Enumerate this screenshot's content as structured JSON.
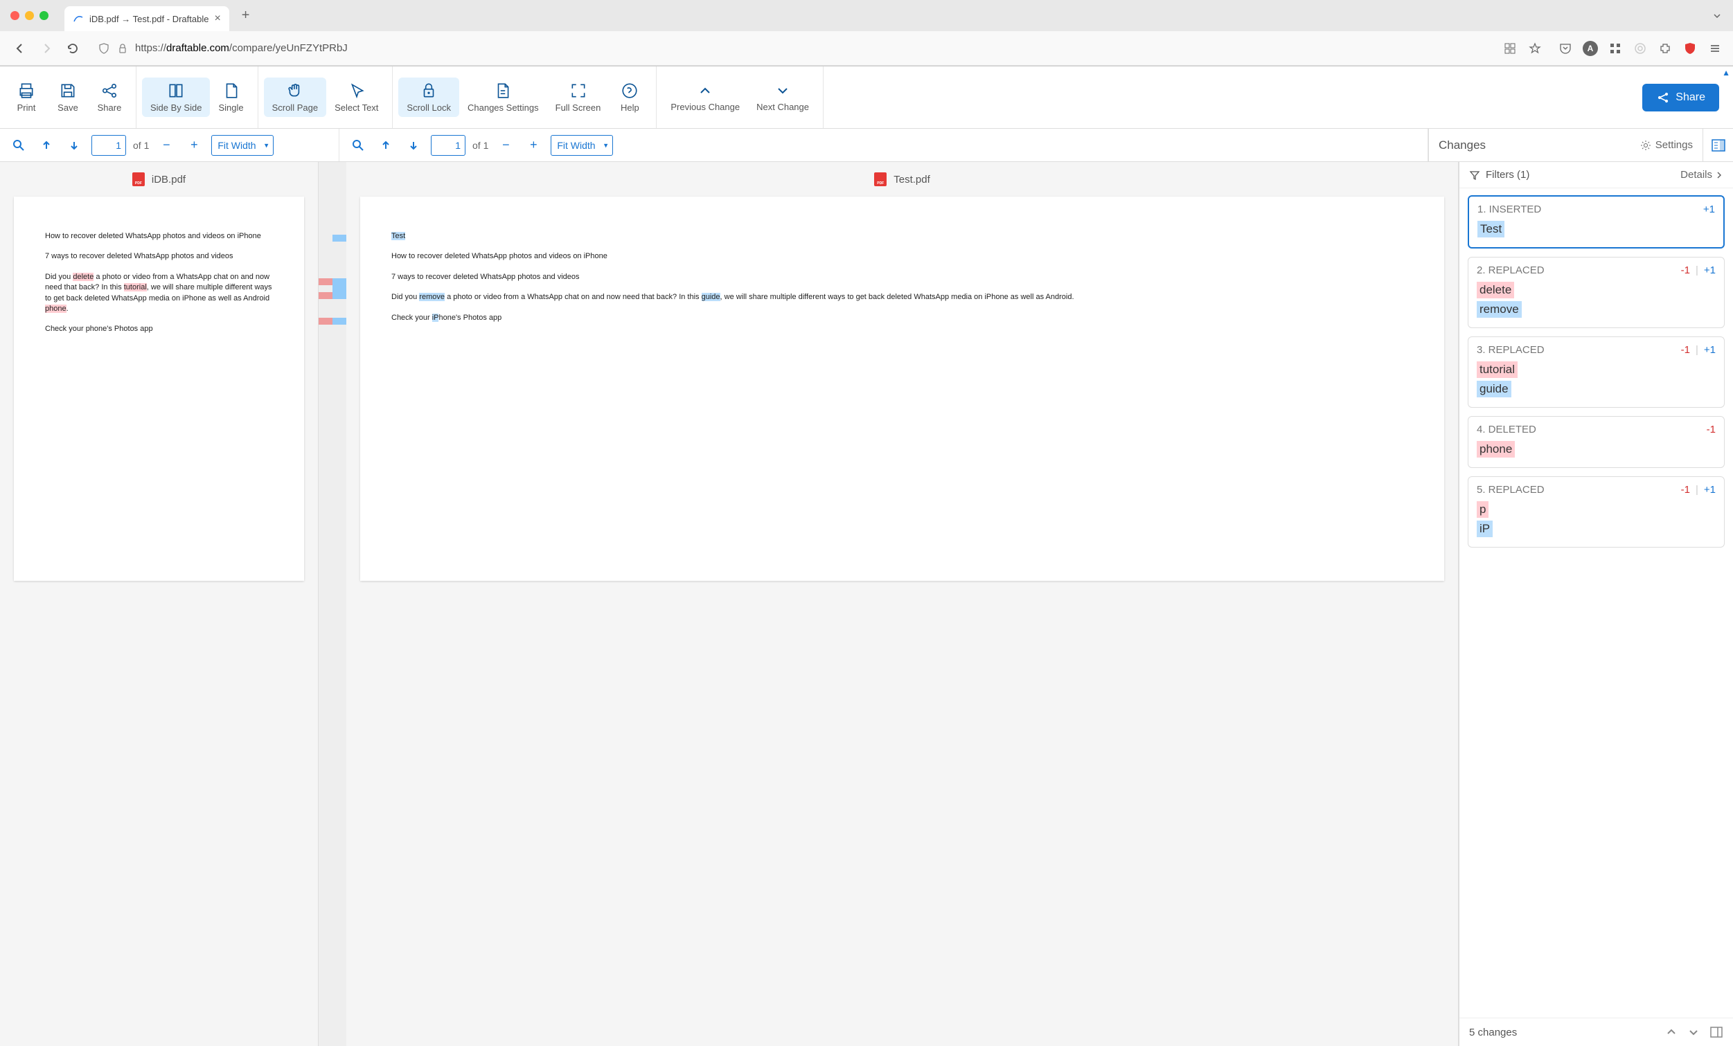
{
  "browser": {
    "tab_title": "iDB.pdf → Test.pdf - Draftable",
    "url_prefix": "https://",
    "url_host": "draftable.com",
    "url_path": "/compare/yeUnFZYtPRbJ",
    "badge_letter": "A"
  },
  "toolbar": {
    "print": "Print",
    "save": "Save",
    "share": "Share",
    "side_by_side": "Side By Side",
    "single": "Single",
    "scroll_page": "Scroll Page",
    "select_text": "Select Text",
    "scroll_lock": "Scroll Lock",
    "changes_settings": "Changes Settings",
    "full_screen": "Full Screen",
    "help": "Help",
    "prev_change": "Previous Change",
    "next_change": "Next Change",
    "share_btn": "Share"
  },
  "left_doc": {
    "page": "1",
    "of": "of 1",
    "zoom": "Fit Width",
    "filename": "iDB.pdf",
    "content": {
      "p1": "How to recover deleted WhatsApp photos and videos on iPhone",
      "p2": "7 ways to recover deleted WhatsApp photos and videos",
      "p3_a": "Did you ",
      "p3_del1": "delete",
      "p3_b": " a photo or video from a WhatsApp chat on and now need that back? In this ",
      "p3_del2": "tutorial",
      "p3_c": ", we will share multiple different ways to get back deleted WhatsApp media on iPhone as well as Android ",
      "p3_del3": "phone",
      "p3_d": ".",
      "p4": "Check your phone's Photos app"
    }
  },
  "right_doc": {
    "page": "1",
    "of": "of 1",
    "zoom": "Fit Width",
    "filename": "Test.pdf",
    "content": {
      "p0_ins": "Test",
      "p1": "How to recover deleted WhatsApp photos and videos on iPhone",
      "p2": "7 ways to recover deleted WhatsApp photos and videos",
      "p3_a": "Did you ",
      "p3_ins1": "remove",
      "p3_b": " a photo or video from a WhatsApp chat on and now need that back? In this ",
      "p3_ins2": "guide",
      "p3_c": ", we will share multiple different ways to get back deleted WhatsApp media on iPhone as well as Android.",
      "p4_a": "Check your ",
      "p4_ins": "iP",
      "p4_b": "hone's Photos app"
    }
  },
  "changes": {
    "title": "Changes",
    "settings": "Settings",
    "filters": "Filters (1)",
    "details": "Details",
    "footer": "5 changes",
    "items": [
      {
        "num": "1.",
        "type": "INSERTED",
        "minus": "",
        "plus": "+1",
        "old": "",
        "new": "Test"
      },
      {
        "num": "2.",
        "type": "REPLACED",
        "minus": "-1",
        "plus": "+1",
        "old": "delete",
        "new": "remove"
      },
      {
        "num": "3.",
        "type": "REPLACED",
        "minus": "-1",
        "plus": "+1",
        "old": "tutorial",
        "new": "guide"
      },
      {
        "num": "4.",
        "type": "DELETED",
        "minus": "-1",
        "plus": "",
        "old": "phone",
        "new": ""
      },
      {
        "num": "5.",
        "type": "REPLACED",
        "minus": "-1",
        "plus": "+1",
        "old": "p",
        "new": "iP"
      }
    ]
  }
}
